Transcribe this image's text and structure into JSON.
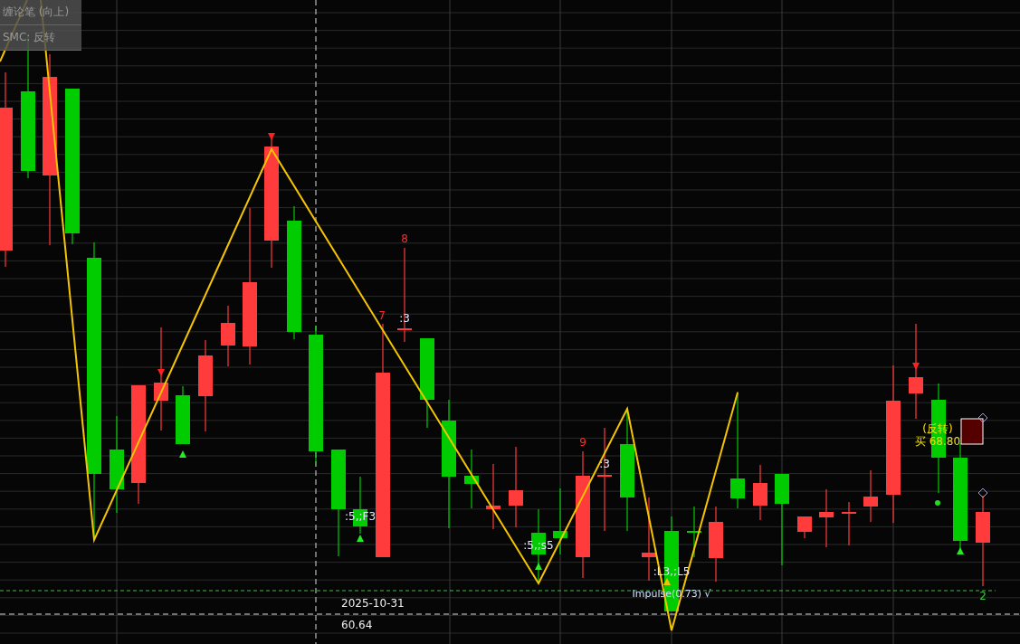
{
  "legend": [
    {
      "text": "缠论笔 (向上)"
    },
    {
      "text": "SMC: 反转"
    }
  ],
  "crosshair": {
    "date": "2025-10-31",
    "price": "60.64"
  },
  "annotations": [
    {
      "text": "8",
      "kind": "count"
    },
    {
      "text": "7",
      "kind": "count"
    },
    {
      "text": ":3",
      "kind": "label"
    },
    {
      "text": "9",
      "kind": "count"
    },
    {
      "text": ":3",
      "kind": "label"
    },
    {
      "text": ":5,;F3",
      "kind": "label"
    },
    {
      "text": ":5,;s5",
      "kind": "label"
    },
    {
      "text": ":L3,;L5",
      "kind": "label"
    },
    {
      "text": "Impulse(0.73) √",
      "kind": "info"
    },
    {
      "text": "(反转)",
      "kind": "signal"
    },
    {
      "text": "买 68.80",
      "kind": "signal"
    },
    {
      "text": "2",
      "kind": "level"
    }
  ]
}
